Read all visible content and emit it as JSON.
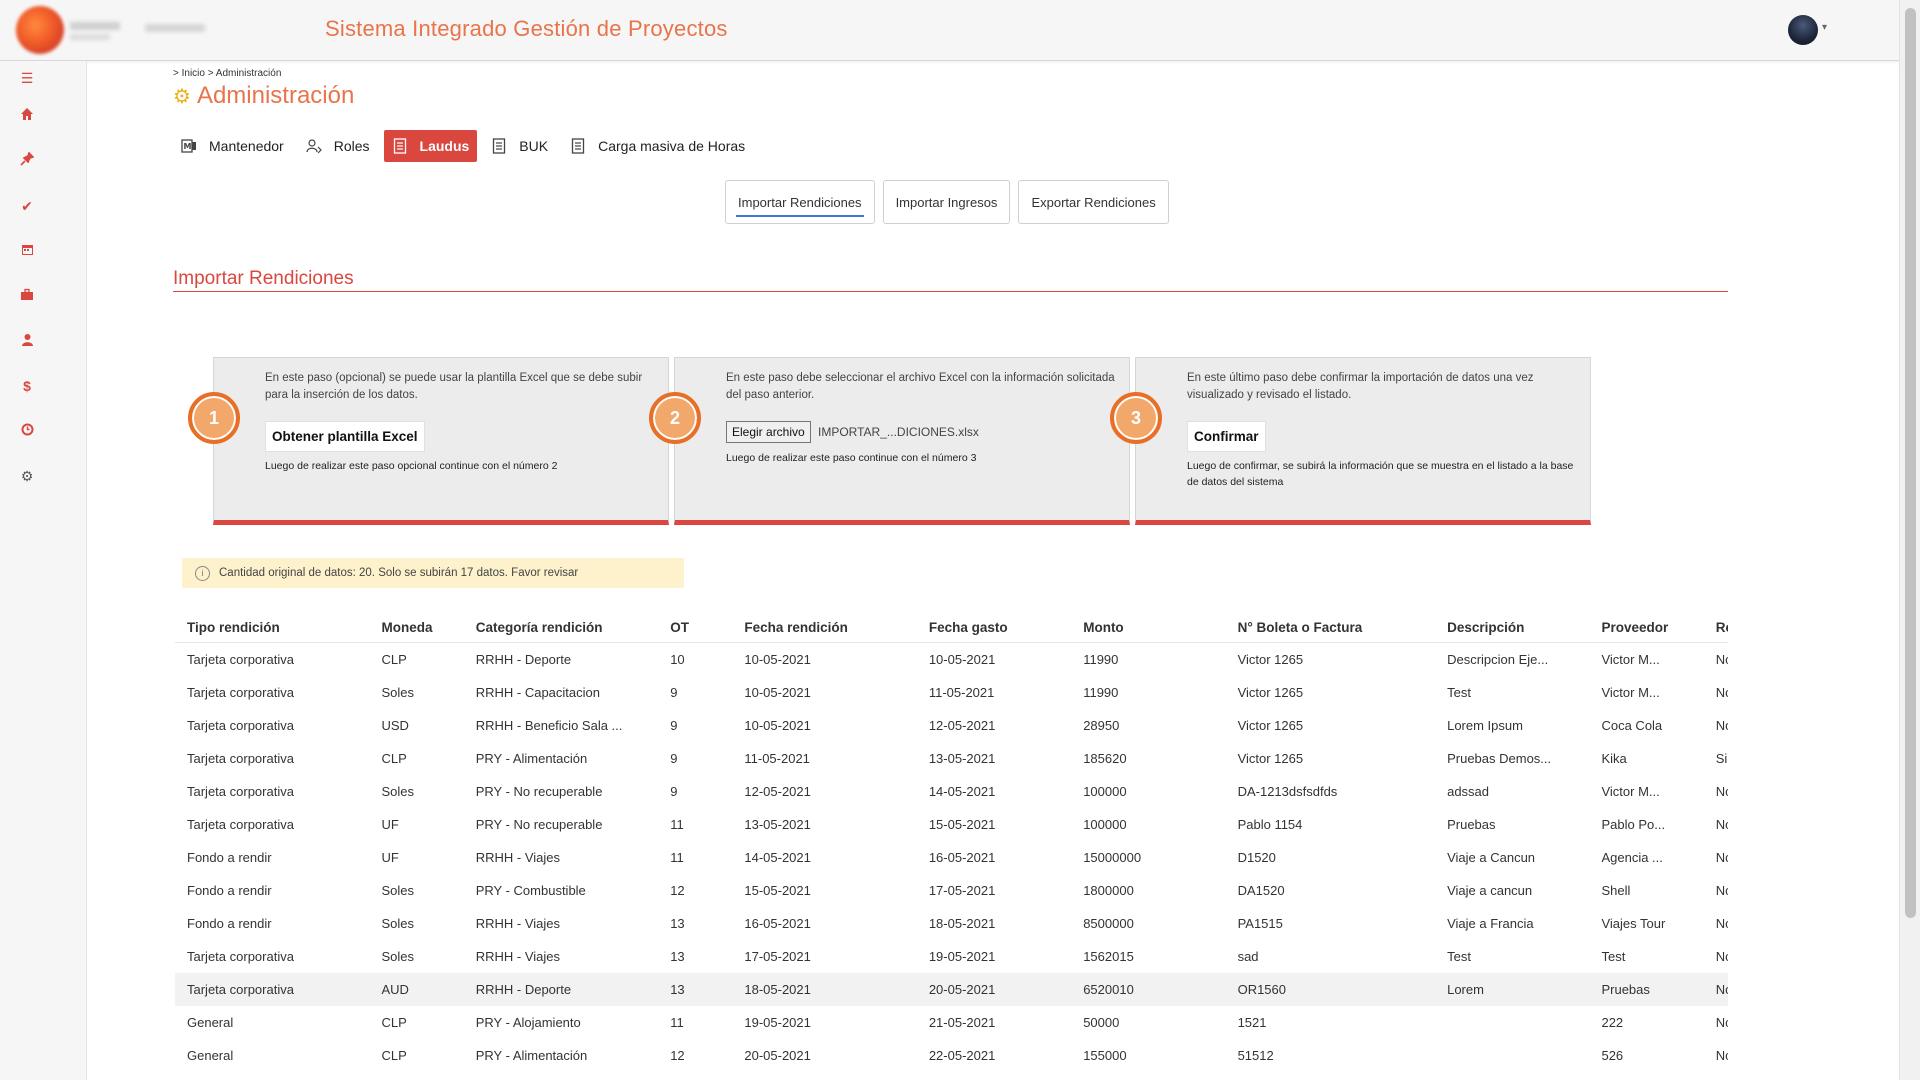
{
  "app": {
    "title": "Sistema Integrado Gestión de Proyectos"
  },
  "breadcrumb": "> Inicio > Administración",
  "page_title": "Administración",
  "sidebar": {
    "icons": [
      "menu-icon",
      "home-icon",
      "pin-icon",
      "check-icon",
      "calendar-icon",
      "briefcase-icon",
      "user-icon",
      "dollar-icon",
      "clock-icon",
      "gear-icon"
    ]
  },
  "nav": {
    "items": [
      {
        "label": "Mantenedor",
        "icon": "mantenedor-icon"
      },
      {
        "label": "Roles",
        "icon": "roles-icon"
      },
      {
        "label": "Laudus",
        "icon": "document-icon",
        "active": true
      },
      {
        "label": "BUK",
        "icon": "document-icon"
      },
      {
        "label": "Carga masiva de Horas",
        "icon": "document-icon"
      }
    ]
  },
  "subtabs": [
    {
      "label": "Importar Rendiciones",
      "active": true
    },
    {
      "label": "Importar Ingresos"
    },
    {
      "label": "Exportar Rendiciones"
    }
  ],
  "section_title": "Importar Rendiciones",
  "steps": [
    {
      "number": "1",
      "text": "En este paso (opcional) se puede usar la plantilla Excel que se debe subir para la inserción de los datos.",
      "button": "Obtener plantilla Excel",
      "note": "Luego de realizar este paso opcional continue con el número 2"
    },
    {
      "number": "2",
      "text": "En este paso debe seleccionar el archivo Excel con la información solicitada del paso anterior.",
      "button": "Elegir archivo",
      "file_name": "IMPORTAR_...DICIONES.xlsx",
      "note": "Luego de realizar este paso continue con el número 3"
    },
    {
      "number": "3",
      "text": "En este último paso debe confirmar la importación de datos una vez visualizado y revisado el listado.",
      "button": "Confirmar",
      "note": "Luego de confirmar, se subirá la información que se muestra en el listado a la base de datos del sistema"
    }
  ],
  "alert": "Cantidad original de datos: 20. Solo se subirán 17 datos. Favor revisar",
  "table": {
    "columns": [
      "Tipo rendición",
      "Moneda",
      "Categoría rendición",
      "OT",
      "Fecha rendición",
      "Fecha gasto",
      "Monto",
      "N° Boleta o Factura",
      "Descripción",
      "Proveedor",
      "Re"
    ],
    "rows": [
      [
        "Tarjeta corporativa",
        "CLP",
        "RRHH - Deporte",
        "10",
        "10-05-2021",
        "10-05-2021",
        "11990",
        "Victor 1265",
        "Descripcion Eje...",
        "Victor M...",
        "Nc"
      ],
      [
        "Tarjeta corporativa",
        "Soles",
        "RRHH - Capacitacion",
        "9",
        "10-05-2021",
        "11-05-2021",
        "11990",
        "Victor 1265",
        "Test",
        "Victor M...",
        "Nc"
      ],
      [
        "Tarjeta corporativa",
        "USD",
        "RRHH - Beneficio Sala ...",
        "9",
        "10-05-2021",
        "12-05-2021",
        "28950",
        "Victor 1265",
        "Lorem Ipsum",
        "Coca Cola",
        "Nc"
      ],
      [
        "Tarjeta corporativa",
        "CLP",
        "PRY - Alimentación",
        "9",
        "11-05-2021",
        "13-05-2021",
        "185620",
        "Victor 1265",
        "Pruebas Demos...",
        "Kika",
        "Si"
      ],
      [
        "Tarjeta corporativa",
        "Soles",
        "PRY - No recuperable",
        "9",
        "12-05-2021",
        "14-05-2021",
        "100000",
        "DA-1213dsfsdfds",
        "adssad",
        "Victor M...",
        "Nc"
      ],
      [
        "Tarjeta corporativa",
        "UF",
        "PRY - No recuperable",
        "11",
        "13-05-2021",
        "15-05-2021",
        "100000",
        "Pablo 1154",
        "Pruebas",
        "Pablo Po...",
        "Nc"
      ],
      [
        "Fondo a rendir",
        "UF",
        "RRHH - Viajes",
        "11",
        "14-05-2021",
        "16-05-2021",
        "15000000",
        "D1520",
        "Viaje a Cancun",
        "Agencia ...",
        "Nc"
      ],
      [
        "Fondo a rendir",
        "Soles",
        "PRY - Combustible",
        "12",
        "15-05-2021",
        "17-05-2021",
        "1800000",
        "DA1520",
        "Viaje a cancun",
        "Shell",
        "Nc"
      ],
      [
        "Fondo a rendir",
        "Soles",
        "RRHH - Viajes",
        "13",
        "16-05-2021",
        "18-05-2021",
        "8500000",
        "PA1515",
        "Viaje a Francia",
        "Viajes Tour",
        "Nc"
      ],
      [
        "Tarjeta corporativa",
        "Soles",
        "RRHH - Viajes",
        "13",
        "17-05-2021",
        "19-05-2021",
        "1562015",
        "sad",
        "Test",
        "Test",
        "Nc"
      ],
      [
        "Tarjeta corporativa",
        "AUD",
        "RRHH - Deporte",
        "13",
        "18-05-2021",
        "20-05-2021",
        "6520010",
        "OR1560",
        "Lorem",
        "Pruebas",
        "Nc"
      ],
      [
        "General",
        "CLP",
        "PRY - Alojamiento",
        "11",
        "19-05-2021",
        "21-05-2021",
        "50000",
        "1521",
        "",
        "222",
        "Nc"
      ],
      [
        "General",
        "CLP",
        "PRY - Alimentación",
        "12",
        "20-05-2021",
        "22-05-2021",
        "155000",
        "51512",
        "",
        "526",
        "Nc"
      ]
    ],
    "highlighted_row": 10
  }
}
